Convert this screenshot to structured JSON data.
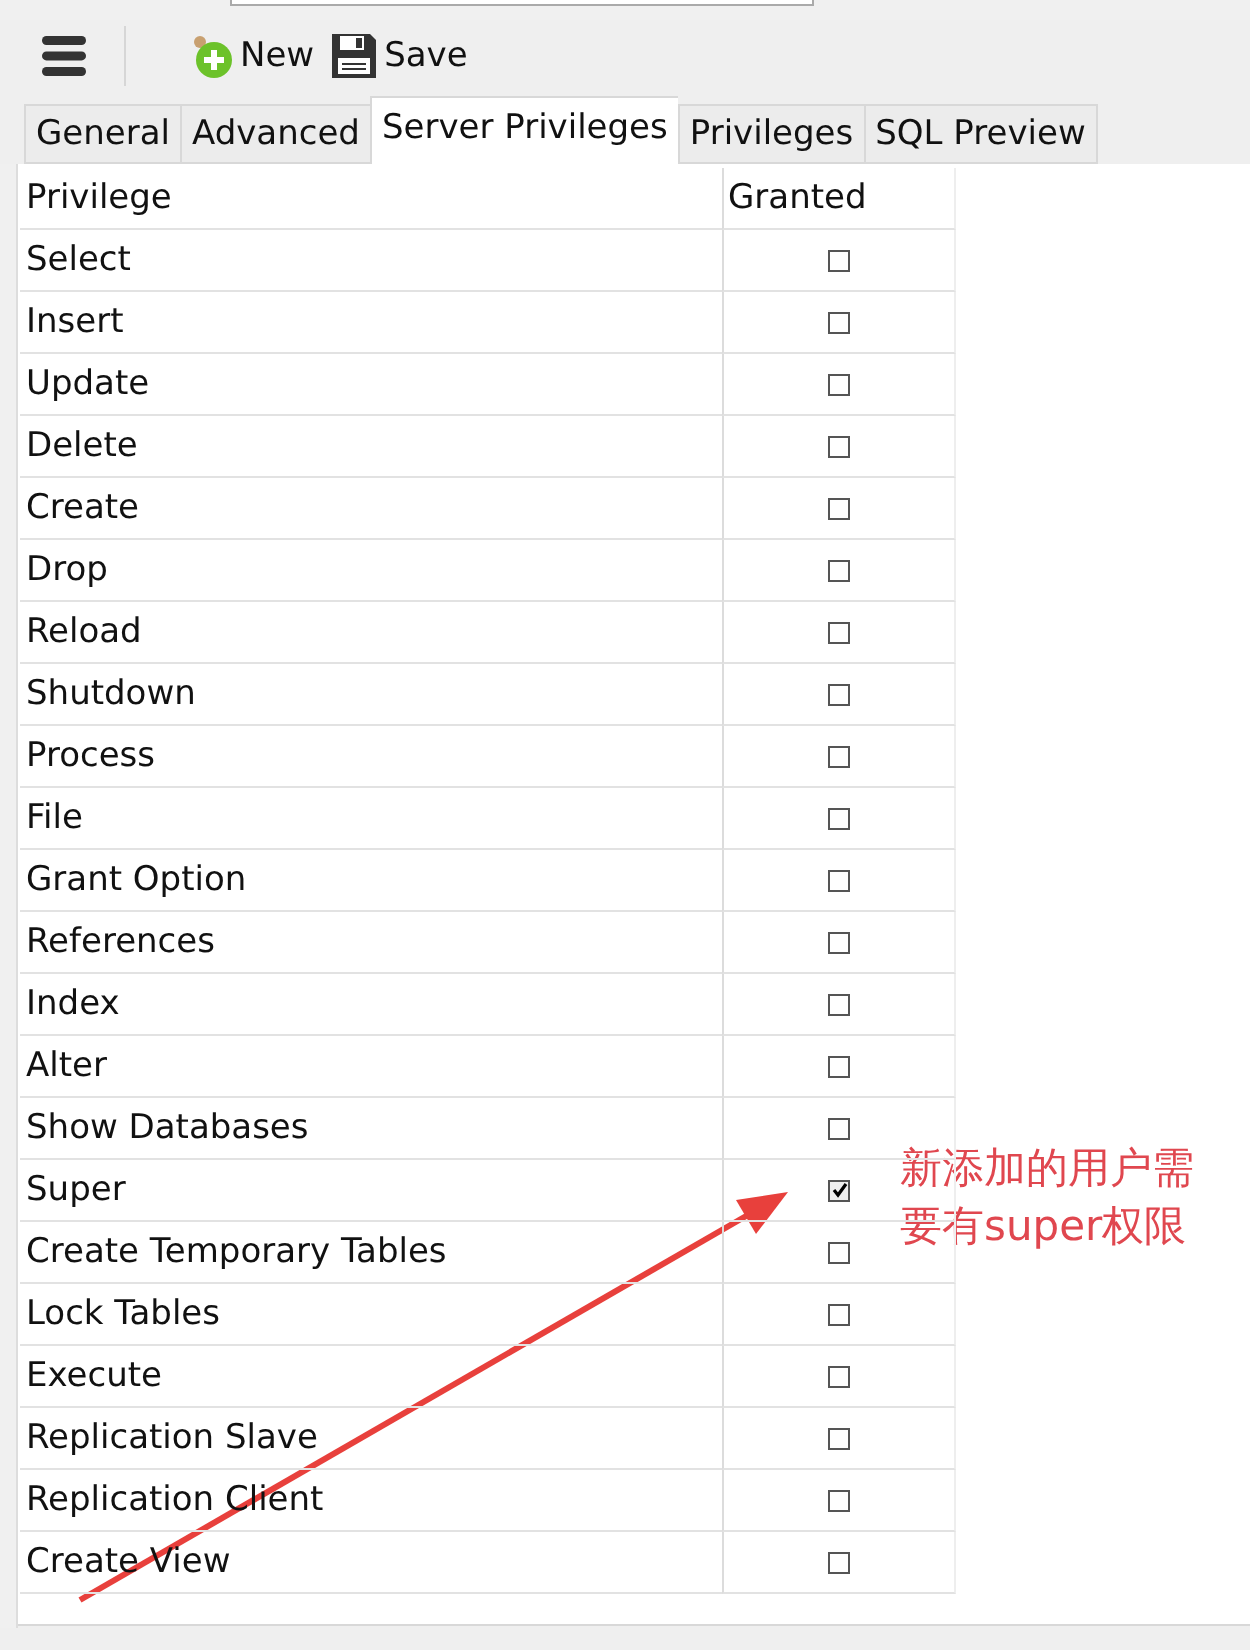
{
  "toolbar": {
    "buttons": [
      {
        "kind": "new",
        "label": "New"
      },
      {
        "kind": "save",
        "label": "Save"
      }
    ]
  },
  "tabs": [
    {
      "label": "General",
      "selected": false
    },
    {
      "label": "Advanced",
      "selected": false
    },
    {
      "label": "Server Privileges",
      "selected": true
    },
    {
      "label": "Privileges",
      "selected": false
    },
    {
      "label": "SQL Preview",
      "selected": false
    }
  ],
  "table": {
    "columns": [
      "Privilege",
      "Granted"
    ],
    "rows": [
      {
        "privilege": "Select",
        "checked": false
      },
      {
        "privilege": "Insert",
        "checked": false
      },
      {
        "privilege": "Update",
        "checked": false
      },
      {
        "privilege": "Delete",
        "checked": false
      },
      {
        "privilege": "Create",
        "checked": false
      },
      {
        "privilege": "Drop",
        "checked": false
      },
      {
        "privilege": "Reload",
        "checked": false
      },
      {
        "privilege": "Shutdown",
        "checked": false
      },
      {
        "privilege": "Process",
        "checked": false
      },
      {
        "privilege": "File",
        "checked": false
      },
      {
        "privilege": "Grant Option",
        "checked": false
      },
      {
        "privilege": "References",
        "checked": false
      },
      {
        "privilege": "Index",
        "checked": false
      },
      {
        "privilege": "Alter",
        "checked": false
      },
      {
        "privilege": "Show Databases",
        "checked": false
      },
      {
        "privilege": "Super",
        "checked": true
      },
      {
        "privilege": "Create Temporary Tables",
        "checked": false
      },
      {
        "privilege": "Lock Tables",
        "checked": false
      },
      {
        "privilege": "Execute",
        "checked": false
      },
      {
        "privilege": "Replication Slave",
        "checked": false
      },
      {
        "privilege": "Replication Client",
        "checked": false
      },
      {
        "privilege": "Create View",
        "checked": false
      }
    ]
  },
  "annotation": {
    "text": "新添加的用户需要有super权限"
  }
}
